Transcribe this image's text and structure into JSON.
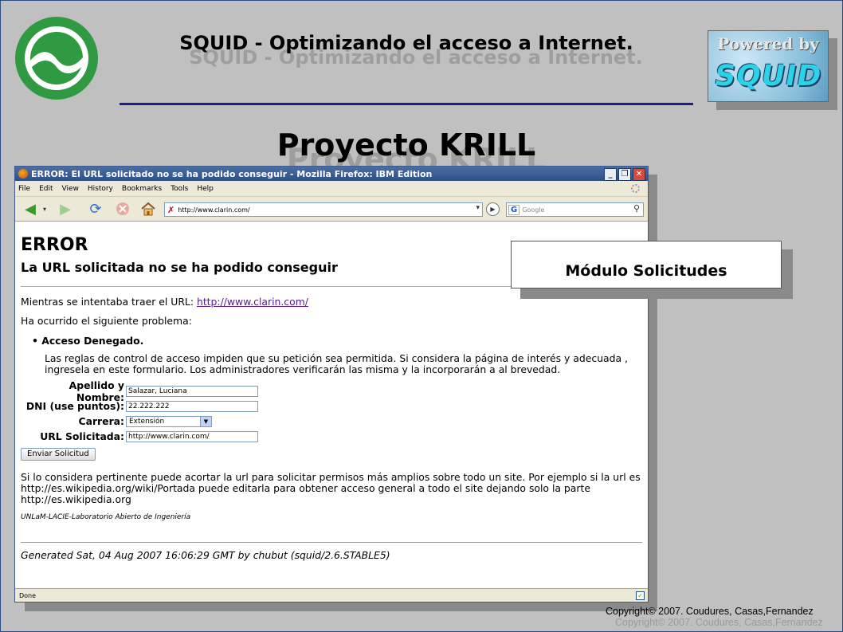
{
  "slide": {
    "header_title": "SQUID - Optimizando el acceso a Internet.",
    "project_title": "Proyecto KRILL",
    "powered_label": "Powered by",
    "powered_brand": "SQUID",
    "callout": "Módulo Solicitudes",
    "copyright": "Copyright© 2007. Coudures, Casas,Fernandez"
  },
  "browser": {
    "window_title": "ERROR: El URL solicitado no se ha podido conseguir - Mozilla Firefox: IBM Edition",
    "menu": [
      "File",
      "Edit",
      "View",
      "History",
      "Bookmarks",
      "Tools",
      "Help"
    ],
    "url": "http://www.clarin.com/",
    "search_placeholder": "Google",
    "status": "Done"
  },
  "page": {
    "error_heading": "ERROR",
    "sub_heading": "La URL solicitada no se ha podido conseguir",
    "trying_prefix": "Mientras se intentaba traer el URL:",
    "trying_link": "http://www.clarin.com/",
    "problem_intro": "Ha ocurrido el siguiente problema:",
    "problem_title": "Acceso Denegado.",
    "problem_desc": "Las reglas de control de acceso impiden que su petición sea permitida. Si considera la página de interés y adecuada , ingresela en este formulario. Los administradores verificarán las misma y la incorporarán a al brevedad.",
    "form": {
      "name_label": "Apellido y Nombre:",
      "name_value": "Salazar, Luciana",
      "dni_label": "DNI (use puntos):",
      "dni_value": "22.222.222",
      "career_label": "Carrera:",
      "career_value": "Extensión",
      "url_label": "URL Solicitada:",
      "url_value": "http://www.clarin.com/",
      "submit_label": "Enviar Solicitud"
    },
    "hint": "Si lo considera pertinente puede acortar la url para solicitar permisos más amplios sobre todo un site. Por ejemplo si la url es http://es.wikipedia.org/wiki/Portada puede editarla para obtener acceso general a todo el site dejando solo la parte http://es.wikipedia.org",
    "lab_name": "UNLaM-LACIE-Laboratorio Abierto de Ingeniería",
    "generated": "Generated Sat, 04 Aug 2007 16:06:29 GMT by chubut (squid/2.6.STABLE5)"
  }
}
